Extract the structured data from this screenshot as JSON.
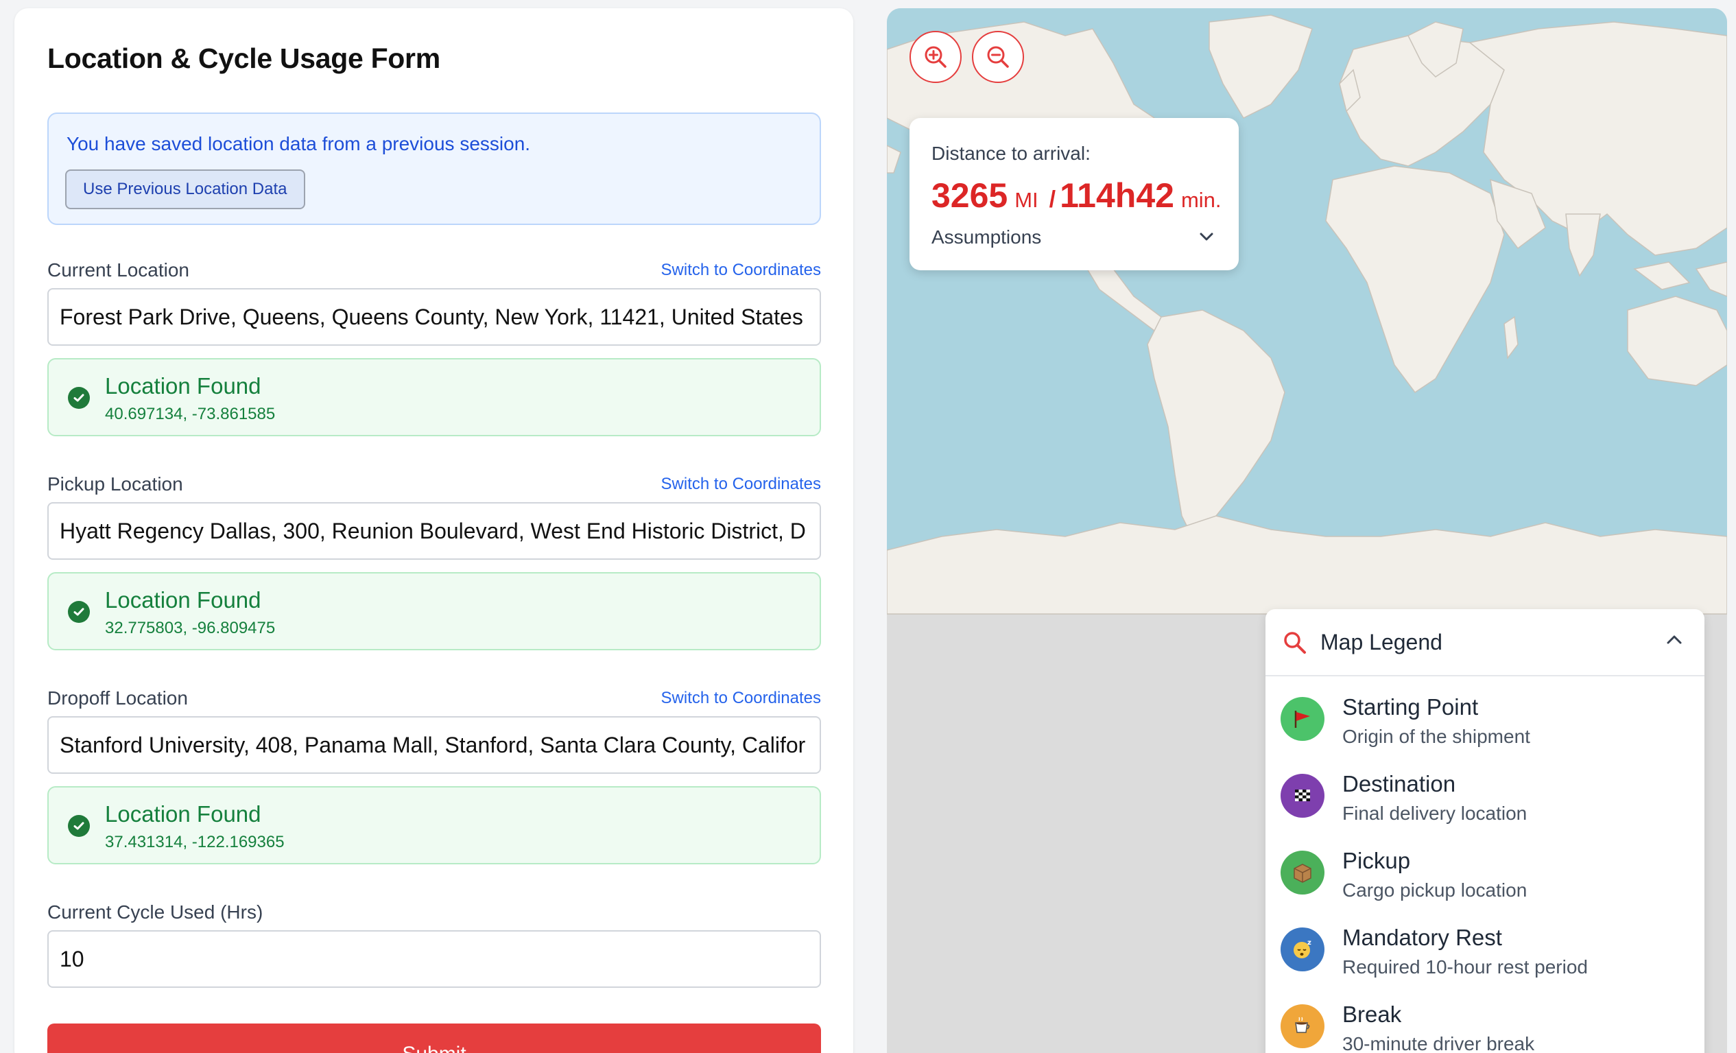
{
  "form": {
    "title": "Location & Cycle Usage Form",
    "saved_notice": "You have saved location data from a previous session.",
    "use_previous_label": "Use Previous Location Data",
    "switch_label": "Switch to Coordinates",
    "found_label": "Location Found",
    "current": {
      "label": "Current Location",
      "value": "Forest Park Drive, Queens, Queens County, New York, 11421, United States",
      "coords": "40.697134, -73.861585"
    },
    "pickup": {
      "label": "Pickup Location",
      "value": "Hyatt Regency Dallas, 300, Reunion Boulevard, West End Historic District, D",
      "coords": "32.775803, -96.809475"
    },
    "dropoff": {
      "label": "Dropoff Location",
      "value": "Stanford University, 408, Panama Mall, Stanford, Santa Clara County, Califor",
      "coords": "37.431314, -122.169365"
    },
    "cycle": {
      "label": "Current Cycle Used (Hrs)",
      "value": "10"
    },
    "submit_label": "Submit"
  },
  "map": {
    "distance_label": "Distance to arrival:",
    "distance_value": "3265",
    "distance_unit": "MI",
    "separator": "/",
    "time_value": "114h42",
    "time_unit": "min.",
    "assumptions_label": "Assumptions"
  },
  "legend": {
    "title": "Map Legend",
    "items": [
      {
        "name": "Starting Point",
        "desc": "Origin of the shipment",
        "icon": "red-flag",
        "color": "#4cc36a"
      },
      {
        "name": "Destination",
        "desc": "Final delivery location",
        "icon": "checkered-flag",
        "color": "#7e3fae"
      },
      {
        "name": "Pickup",
        "desc": "Cargo pickup location",
        "icon": "package",
        "color": "#4bb05a"
      },
      {
        "name": "Mandatory Rest",
        "desc": "Required 10-hour rest period",
        "icon": "sleeping-face",
        "color": "#3b77c2"
      },
      {
        "name": "Break",
        "desc": "30-minute driver break",
        "icon": "coffee-cup",
        "color": "#f0a63a"
      }
    ]
  },
  "colors": {
    "accent": "#e53e3e",
    "link": "#2563eb",
    "success": "#15803d",
    "ocean": "#aad3df",
    "land": "#f2efe9"
  }
}
